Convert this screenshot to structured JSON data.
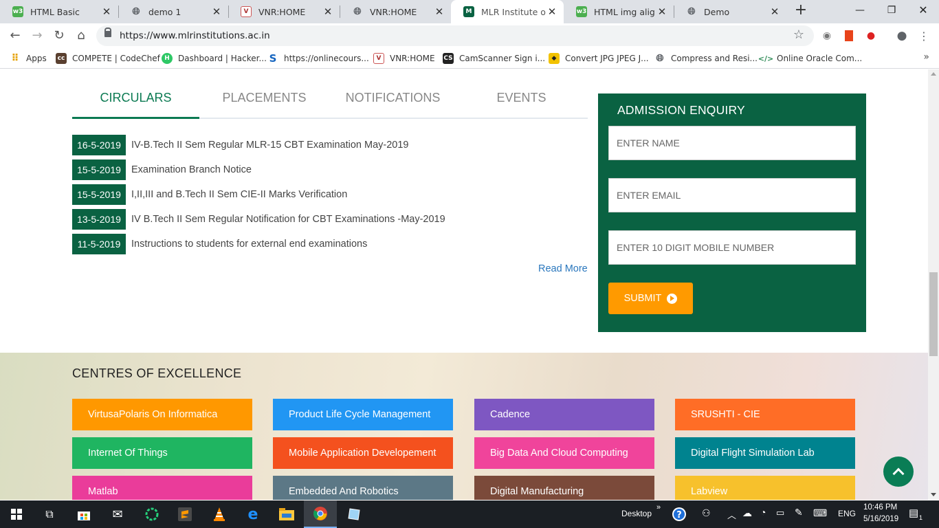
{
  "browser": {
    "tabs": [
      {
        "title": "HTML Basic",
        "icon": "w3schools-icon",
        "color": "#4caf50"
      },
      {
        "title": "demo 1",
        "icon": "globe-icon",
        "color": "#5f6368"
      },
      {
        "title": "VNR:HOME",
        "icon": "vnr-crest-icon",
        "color": "#a33"
      },
      {
        "title": "VNR:HOME",
        "icon": "globe-icon",
        "color": "#5f6368"
      },
      {
        "title": "MLR Institute of Te",
        "icon": "mlr-logo-icon",
        "color": "#0a6242",
        "active": true
      },
      {
        "title": "HTML img align At",
        "icon": "w3schools-icon",
        "color": "#4caf50"
      },
      {
        "title": "Demo",
        "icon": "globe-icon",
        "color": "#5f6368"
      }
    ],
    "url": "https://www.mlrinstitutions.ac.in",
    "bookmarks": [
      {
        "label": "Apps",
        "icon": "apps-grid-icon"
      },
      {
        "label": "COMPETE | CodeChef",
        "icon": "codechef-icon"
      },
      {
        "label": "Dashboard | Hacker...",
        "icon": "hackerrank-icon"
      },
      {
        "label": "https://onlinecours...",
        "icon": "swayam-icon"
      },
      {
        "label": "VNR:HOME",
        "icon": "vnr-crest-icon"
      },
      {
        "label": "CamScanner Sign i...",
        "icon": "camscanner-icon"
      },
      {
        "label": "Convert JPG JPEG J...",
        "icon": "convert-icon"
      },
      {
        "label": "Compress and Resi...",
        "icon": "globe-icon"
      },
      {
        "label": "Online Oracle Com...",
        "icon": "code-icon"
      }
    ]
  },
  "page": {
    "nav_tabs": [
      "CIRCULARS",
      "PLACEMENTS",
      "NOTIFICATIONS",
      "EVENTS"
    ],
    "circulars": [
      {
        "date": "16-5-2019",
        "text": "IV-B.Tech II Sem Regular MLR-15 CBT Examination May-2019"
      },
      {
        "date": "15-5-2019",
        "text": "Examination Branch Notice"
      },
      {
        "date": "15-5-2019",
        "text": "I,II,III and B.Tech II Sem CIE-II Marks Verification"
      },
      {
        "date": "13-5-2019",
        "text": "IV B.Tech II Sem Regular Notification for CBT Examinations -May-2019"
      },
      {
        "date": "11-5-2019",
        "text": "Instructions to students for external end examinations"
      }
    ],
    "read_more": "Read More",
    "enquiry": {
      "title": "ADMISSION ENQUIRY",
      "name_placeholder": "ENTER NAME",
      "email_placeholder": "ENTER EMAIL",
      "mobile_placeholder": "ENTER 10 DIGIT MOBILE NUMBER",
      "submit": "SUBMIT"
    },
    "coe_title": "CENTRES OF EXCELLENCE",
    "coe": [
      {
        "label": "VirtusaPolaris On Informatica",
        "color": "#ff9800"
      },
      {
        "label": "Product Life Cycle Management",
        "color": "#2196f3"
      },
      {
        "label": "Cadence",
        "color": "#7e57c2"
      },
      {
        "label": "SRUSHTI - CIE",
        "color": "#ff6d26"
      },
      {
        "label": "Internet Of Things",
        "color": "#1fb561"
      },
      {
        "label": "Mobile Application Developement",
        "color": "#f4511e"
      },
      {
        "label": "Big Data And Cloud Computing",
        "color": "#f0449b"
      },
      {
        "label": "Digital Flight Simulation Lab",
        "color": "#00838f"
      },
      {
        "label": "Matlab",
        "color": "#ea3c9a"
      },
      {
        "label": "Embedded And Robotics",
        "color": "#5c7886"
      },
      {
        "label": "Digital Manufacturing",
        "color": "#7b4a3a"
      },
      {
        "label": "Labview",
        "color": "#f7c12c"
      }
    ]
  },
  "taskbar": {
    "desktop_label": "Desktop",
    "language": "ENG",
    "time": "10:46 PM",
    "date": "5/16/2019",
    "notifications": "1"
  }
}
